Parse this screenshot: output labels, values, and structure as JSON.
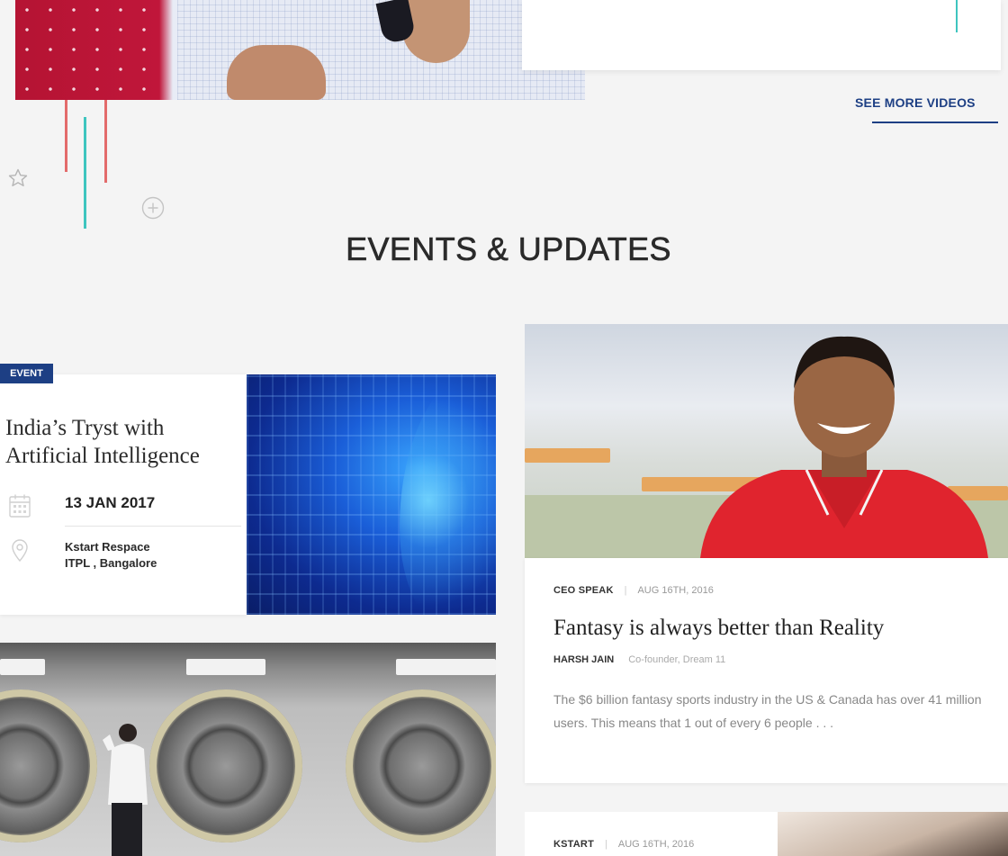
{
  "videos": {
    "see_more_label": "SEE MORE VIDEOS"
  },
  "section": {
    "title": "EVENTS & UPDATES"
  },
  "event": {
    "badge": "EVENT",
    "title": "India’s Tryst with Artificial Intelligence",
    "date": "13 JAN 2017",
    "venue_line1": "Kstart Respace",
    "venue_line2": "ITPL , Bangalore"
  },
  "article": {
    "category": "CEO SPEAK",
    "date": "AUG 16TH, 2016",
    "title": "Fantasy is always better than Reality",
    "author_name": "HARSH JAIN",
    "author_role": "Co-founder, Dream 11",
    "excerpt": "The $6 billion fantasy sports industry in the US & Canada has over 41 million users.  This means that 1 out of every 6 people . . ."
  },
  "next_article": {
    "category": "KSTART",
    "date": "AUG 16TH, 2016"
  },
  "icons": {
    "star": "star-outline-icon",
    "plus": "plus-circle-icon",
    "calendar": "calendar-icon",
    "location": "location-pin-icon"
  },
  "colors": {
    "brand_blue": "#1d3f84",
    "accent_red": "#e36b6b",
    "accent_teal": "#3ec5bf",
    "background": "#f4f4f4"
  }
}
